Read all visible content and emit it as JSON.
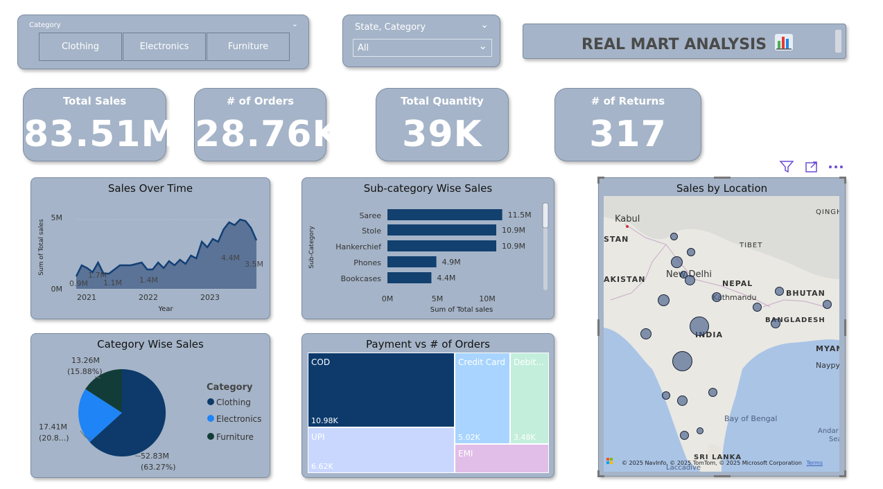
{
  "category_slicer": {
    "header": "Category",
    "options": [
      "Clothing",
      "Electronics",
      "Furniture"
    ]
  },
  "state_slicer": {
    "header": "State, Category",
    "selected": "All"
  },
  "banner": {
    "title": "REAL MART ANALYSIS"
  },
  "kpis": [
    {
      "label": "Total Sales",
      "value": "83.51M"
    },
    {
      "label": "# of Orders",
      "value": "28.76K"
    },
    {
      "label": "Total Quantity",
      "value": "39K"
    },
    {
      "label": "# of Returns",
      "value": "317"
    }
  ],
  "sales_over_time": {
    "title": "Sales Over Time",
    "ylabel": "Sum of Total sales",
    "xlabel": "Year",
    "y_ticks": [
      "5M",
      "0M"
    ],
    "x_ticks": [
      "2021",
      "2022",
      "2023"
    ],
    "labels": [
      "0.9M",
      "1.7M",
      "1.1M",
      "1.4M",
      "4.4M",
      "3.5M"
    ]
  },
  "subcategory": {
    "title": "Sub-category Wise Sales",
    "ylabel": "Sub-Category",
    "xlabel": "Sum of Total sales",
    "x_ticks": [
      "0M",
      "5M",
      "10M"
    ],
    "items": [
      {
        "name": "Saree",
        "label": "11.5M"
      },
      {
        "name": "Stole",
        "label": "10.9M"
      },
      {
        "name": "Hankerchief",
        "label": "10.9M"
      },
      {
        "name": "Phones",
        "label": "4.9M"
      },
      {
        "name": "Bookcases",
        "label": "4.4M"
      }
    ]
  },
  "category_pie": {
    "title": "Category Wise Sales",
    "legend_title": "Category",
    "legend": [
      "Clothing",
      "Electronics",
      "Furniture"
    ],
    "slice_labels": {
      "clothing_value": "52.83M",
      "clothing_pct": "(63.27%)",
      "electronics_value": "17.41M",
      "electronics_pct": "(20.8...)",
      "furniture_value": "13.26M",
      "furniture_pct": "(15.88%)"
    }
  },
  "payment": {
    "title": "Payment vs # of Orders",
    "tiles": {
      "cod": {
        "label": "COD",
        "value": "10.98K"
      },
      "upi": {
        "label": "UPI",
        "value": "6.62K"
      },
      "credit": {
        "label": "Credit Card",
        "value": "5.02K"
      },
      "debit": {
        "label": "Debit...",
        "value": "3.48K"
      },
      "emi": {
        "label": "EMI",
        "value": ""
      }
    }
  },
  "map": {
    "title": "Sales by Location",
    "places": {
      "kabul": "Kabul",
      "stan": "STAN",
      "pakistan": "AKISTAN",
      "delhi": "New Delhi",
      "nepal": "NEPAL",
      "kathmandu": "Kathmandu",
      "bhutan": "BHUTAN",
      "tibet": "TIBET",
      "qinghai": "QINGH",
      "bangladesh": "BANGLADESH",
      "india": "INDIA",
      "myanmar": "MYAN",
      "naypyi": "Naypy",
      "bay": "Bay of Bengal",
      "andaman": "Andar",
      "sea": "Sea",
      "srilanka": "SRI LANKA",
      "laccadive": "Laccadive"
    },
    "attribution": "© 2025 NavInfo, © 2025 TomTom, © 2025 Microsoft Corporation",
    "terms": "Terms"
  },
  "chart_data": [
    {
      "type": "area",
      "title": "Sales Over Time",
      "xlabel": "Year",
      "ylabel": "Sum of Total sales",
      "x": [
        "2021-01",
        "2021-02",
        "2021-03",
        "2021-04",
        "2021-05",
        "2021-06",
        "2021-07",
        "2021-08",
        "2021-09",
        "2021-10",
        "2021-11",
        "2021-12",
        "2022-01",
        "2022-02",
        "2022-03",
        "2022-04",
        "2022-05",
        "2022-06",
        "2022-07",
        "2022-08",
        "2022-09",
        "2022-10",
        "2022-11",
        "2022-12",
        "2023-01",
        "2023-02",
        "2023-03",
        "2023-04",
        "2023-05",
        "2023-06",
        "2023-07",
        "2023-08",
        "2023-09",
        "2023-10"
      ],
      "values": [
        0.9,
        1.7,
        1.5,
        1.2,
        1.9,
        1.1,
        1.1,
        1.4,
        1.7,
        1.7,
        1.7,
        1.8,
        1.9,
        1.4,
        1.4,
        1.9,
        1.5,
        2.0,
        1.7,
        2.1,
        1.8,
        2.4,
        2.2,
        3.4,
        3.0,
        3.6,
        3.4,
        4.3,
        4.8,
        4.6,
        5.0,
        4.9,
        4.4,
        3.5
      ],
      "ylim": [
        0,
        6.5
      ]
    },
    {
      "type": "bar",
      "title": "Sub-category Wise Sales",
      "categories": [
        "Saree",
        "Stole",
        "Hankerchief",
        "Phones",
        "Bookcases"
      ],
      "values": [
        11.5,
        10.9,
        10.9,
        4.9,
        4.4
      ],
      "xlabel": "Sum of Total sales",
      "ylabel": "Sub-Category",
      "xlim": [
        0,
        13.5
      ]
    },
    {
      "type": "pie",
      "title": "Category Wise Sales",
      "categories": [
        "Clothing",
        "Electronics",
        "Furniture"
      ],
      "values": [
        52.83,
        17.41,
        13.26
      ],
      "percent": [
        63.27,
        20.85,
        15.88
      ],
      "colors": [
        "#0d3a6b",
        "#1f84f5",
        "#123c38"
      ]
    },
    {
      "type": "treemap",
      "title": "Payment vs # of Orders",
      "categories": [
        "COD",
        "UPI",
        "Credit Card",
        "Debit...",
        "EMI"
      ],
      "values": [
        10.98,
        6.62,
        5.02,
        3.48,
        2.2
      ]
    }
  ]
}
